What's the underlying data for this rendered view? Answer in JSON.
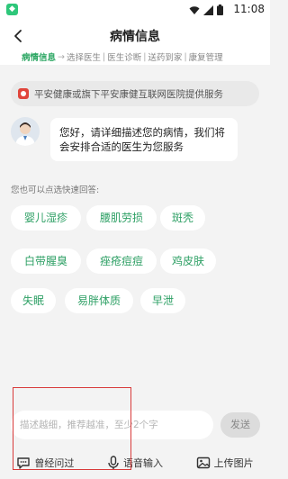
{
  "status_bar": {
    "time": "11:08"
  },
  "header": {
    "title": "病情信息"
  },
  "steps": [
    {
      "label": "病情信息",
      "active": true
    },
    {
      "label": "选择医生",
      "active": false
    },
    {
      "label": "医生诊断",
      "active": false
    },
    {
      "label": "送药到家",
      "active": false
    },
    {
      "label": "康复管理",
      "active": false
    }
  ],
  "notice": {
    "text": "平安健康或旗下平安康健互联网医院提供服务"
  },
  "message": {
    "text": "您好，请详细描述您的病情，我们将会安排合适的医生为您服务"
  },
  "quick": {
    "label": "您也可以点选快速回答:",
    "chips": [
      "婴儿湿疹",
      "腰肌劳损",
      "斑秃",
      "白带腥臭",
      "痤疮痘痘",
      "鸡皮肤",
      "失眠",
      "易胖体质",
      "早泄"
    ]
  },
  "composer": {
    "placeholder": "描述越细，推荐越准，至少2个字",
    "send_label": "发送"
  },
  "toolbar": {
    "history": "曾经问过",
    "voice": "语音输入",
    "image": "上传图片"
  },
  "colors": {
    "accent": "#2fa865",
    "highlight_box": "#d83a3a"
  }
}
